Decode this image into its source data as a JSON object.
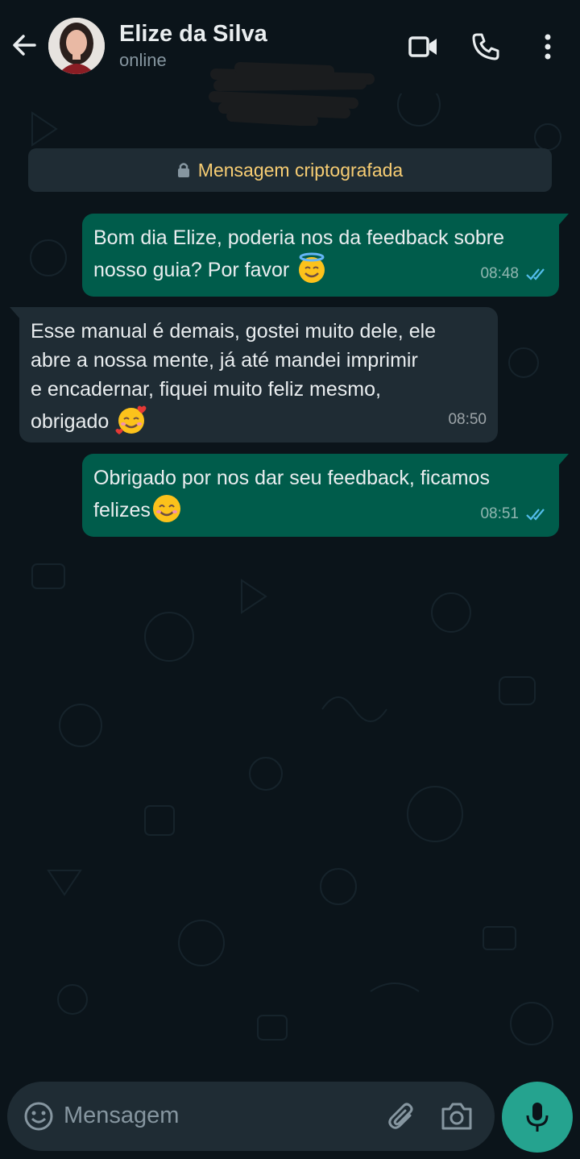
{
  "header": {
    "contact_name": "Elize da Silva",
    "status": "online"
  },
  "encryption_notice": "Mensagem criptografada",
  "messages": [
    {
      "direction": "outgoing",
      "text": "Bom dia Elize, poderia nos da feedback sobre\nnosso guia? Por favor",
      "emoji": "smiling-face-with-halo",
      "time": "08:48",
      "read": true
    },
    {
      "direction": "incoming",
      "text": "Esse manual é demais,  gostei muito dele, ele\nabre a nossa mente, já até mandei imprimir\ne encadernar,  fiquei muito feliz mesmo,\nobrigado",
      "emoji": "smiling-face-with-hearts",
      "time": "08:50"
    },
    {
      "direction": "outgoing",
      "text": "Obrigado por nos dar seu feedback,  ficamos\nfelizes",
      "emoji": "smiling-face-with-smiling-eyes",
      "time": "08:51",
      "read": true
    }
  ],
  "input": {
    "placeholder": "Mensagem"
  },
  "colors": {
    "background": "#0b141a",
    "outgoing_bubble": "#005c4b",
    "incoming_bubble": "#1f2c34",
    "encryption_text": "#f7cd73",
    "read_ticks": "#53bdeb",
    "mic_button": "#25a38f"
  }
}
